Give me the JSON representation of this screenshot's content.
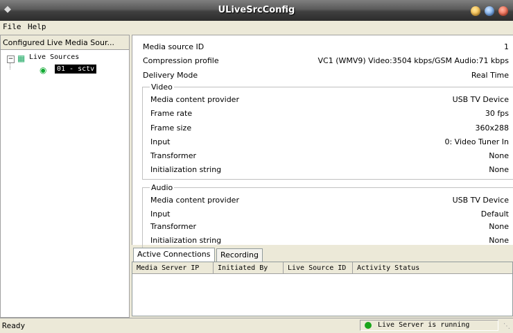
{
  "window": {
    "title": "ULiveSrcConfig"
  },
  "menu": {
    "file": "File",
    "help": "Help"
  },
  "tree": {
    "header": "Configured Live Media Sour...",
    "root_label": "Live Sources",
    "expander": "−",
    "child_label": "01 - sctv"
  },
  "props": {
    "media_source_id_label": "Media source ID",
    "media_source_id": "1",
    "compression_profile_label": "Compression profile",
    "compression_profile": "VC1 (WMV9) Video:3504 kbps/GSM Audio:71 kbps",
    "delivery_mode_label": "Delivery Mode",
    "delivery_mode": "Real Time"
  },
  "video": {
    "title": "Video",
    "provider_label": "Media content provider",
    "provider": "USB TV Device",
    "frame_rate_label": "Frame rate",
    "frame_rate": "30 fps",
    "frame_size_label": "Frame size",
    "frame_size": "360x288",
    "input_label": "Input",
    "input": "0: Video Tuner In",
    "transformer_label": "Transformer",
    "transformer": "None",
    "init_label": "Initialization string",
    "init": "None"
  },
  "audio": {
    "title": "Audio",
    "provider_label": "Media content provider",
    "provider": "USB TV Device",
    "input_label": "Input",
    "input": "Default",
    "transformer_label": "Transformer",
    "transformer": "None",
    "init_label": "Initialization string",
    "init": "None"
  },
  "tabs": {
    "active": "Active Connections",
    "recording": "Recording"
  },
  "columns": [
    "Media Server IP",
    "Initiated By",
    "Live Source ID",
    "Activity Status"
  ],
  "status": {
    "left": "Ready",
    "server": "Live Server is running"
  },
  "colors": {
    "status_ok": "#1aa51a"
  },
  "icons": {
    "title": "app-icon",
    "root": "live-sources-icon",
    "child": "camera-icon"
  }
}
